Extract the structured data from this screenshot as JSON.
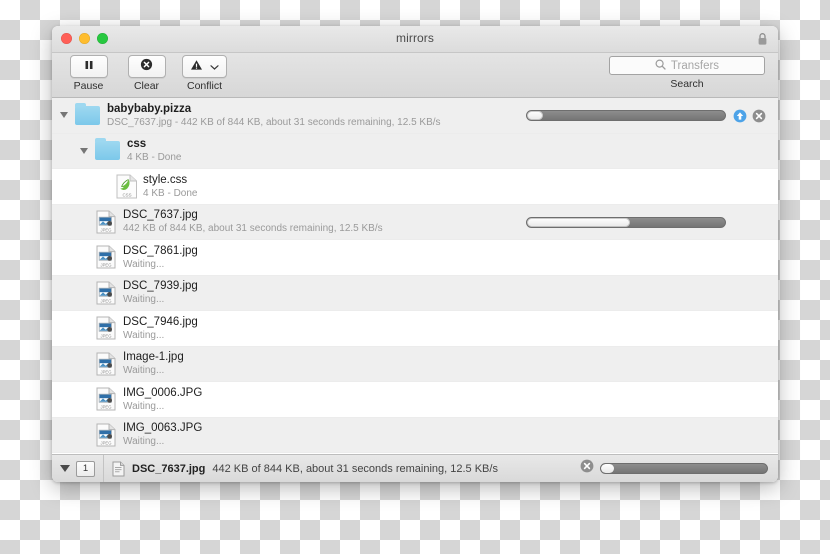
{
  "window": {
    "title": "mirrors",
    "lock_icon": "lock-icon"
  },
  "toolbar": {
    "buttons": [
      {
        "label": "Pause",
        "icon": "pause-icon"
      },
      {
        "label": "Clear",
        "icon": "clear-x-circle-icon"
      },
      {
        "label": "Conflict",
        "icon": "warning-triangle-icon",
        "has_chevron": true
      }
    ],
    "search": {
      "placeholder": "Transfers",
      "value": "",
      "icon": "search-icon",
      "label": "Search"
    }
  },
  "transfers": [
    {
      "name": "babybaby.pizza",
      "status": "DSC_7637.jpg - 442 KB of 844 KB, about 31 seconds remaining, 12.5 KB/s",
      "icon": "folder-icon",
      "type": "folder",
      "bold": true,
      "indent": 0,
      "disclosure": true,
      "progress": 8,
      "has_progress": true,
      "actions": [
        "upload-arrow-icon",
        "cancel-x-icon"
      ],
      "stripe": "even"
    },
    {
      "name": "css",
      "status": "4 KB - Done",
      "icon": "folder-icon",
      "type": "folder",
      "bold": true,
      "indent": 1,
      "disclosure": true,
      "has_progress": false,
      "stripe": "even"
    },
    {
      "name": "style.css",
      "status": "4 KB - Done",
      "icon": "css-file-icon",
      "type": "file",
      "bold": false,
      "indent": 2,
      "disclosure": false,
      "has_progress": false,
      "stripe": "odd"
    },
    {
      "name": "DSC_7637.jpg",
      "status": "442 KB of 844 KB, about 31 seconds remaining, 12.5 KB/s",
      "icon": "jpeg-file-icon",
      "type": "file",
      "bold": false,
      "indent": 1,
      "disclosure": false,
      "has_progress": true,
      "progress": 52,
      "stripe": "even"
    },
    {
      "name": "DSC_7861.jpg",
      "status": "Waiting...",
      "icon": "jpeg-file-icon",
      "type": "file",
      "bold": false,
      "indent": 1,
      "disclosure": false,
      "has_progress": false,
      "stripe": "odd"
    },
    {
      "name": "DSC_7939.jpg",
      "status": "Waiting...",
      "icon": "jpeg-file-icon",
      "type": "file",
      "bold": false,
      "indent": 1,
      "disclosure": false,
      "has_progress": false,
      "stripe": "even"
    },
    {
      "name": "DSC_7946.jpg",
      "status": "Waiting...",
      "icon": "jpeg-file-icon",
      "type": "file",
      "bold": false,
      "indent": 1,
      "disclosure": false,
      "has_progress": false,
      "stripe": "odd"
    },
    {
      "name": "Image-1.jpg",
      "status": "Waiting...",
      "icon": "jpeg-file-icon",
      "type": "file",
      "bold": false,
      "indent": 1,
      "disclosure": false,
      "has_progress": false,
      "stripe": "even"
    },
    {
      "name": "IMG_0006.JPG",
      "status": "Waiting...",
      "icon": "jpeg-file-icon",
      "type": "file",
      "bold": false,
      "indent": 1,
      "disclosure": false,
      "has_progress": false,
      "stripe": "odd"
    },
    {
      "name": "IMG_0063.JPG",
      "status": "Waiting...",
      "icon": "jpeg-file-icon",
      "type": "file",
      "bold": false,
      "indent": 1,
      "disclosure": false,
      "has_progress": false,
      "stripe": "even"
    }
  ],
  "statusbar": {
    "badge_count": "1",
    "file_name": "DSC_7637.jpg",
    "status": "442 KB of 844 KB, about 31 seconds remaining, 12.5 KB/s",
    "progress": 8,
    "cancel_icon": "cancel-x-icon",
    "disclosure_icon": "triangle-down-icon",
    "doc_icon": "document-icon"
  },
  "colors": {
    "accent_blue": "#4da3e8",
    "folder_blue": "#7cc8ea",
    "css_green": "#6abf3f",
    "traffic_red": "#ff5f57",
    "traffic_yellow": "#ffbd2e",
    "traffic_green": "#28c840"
  }
}
